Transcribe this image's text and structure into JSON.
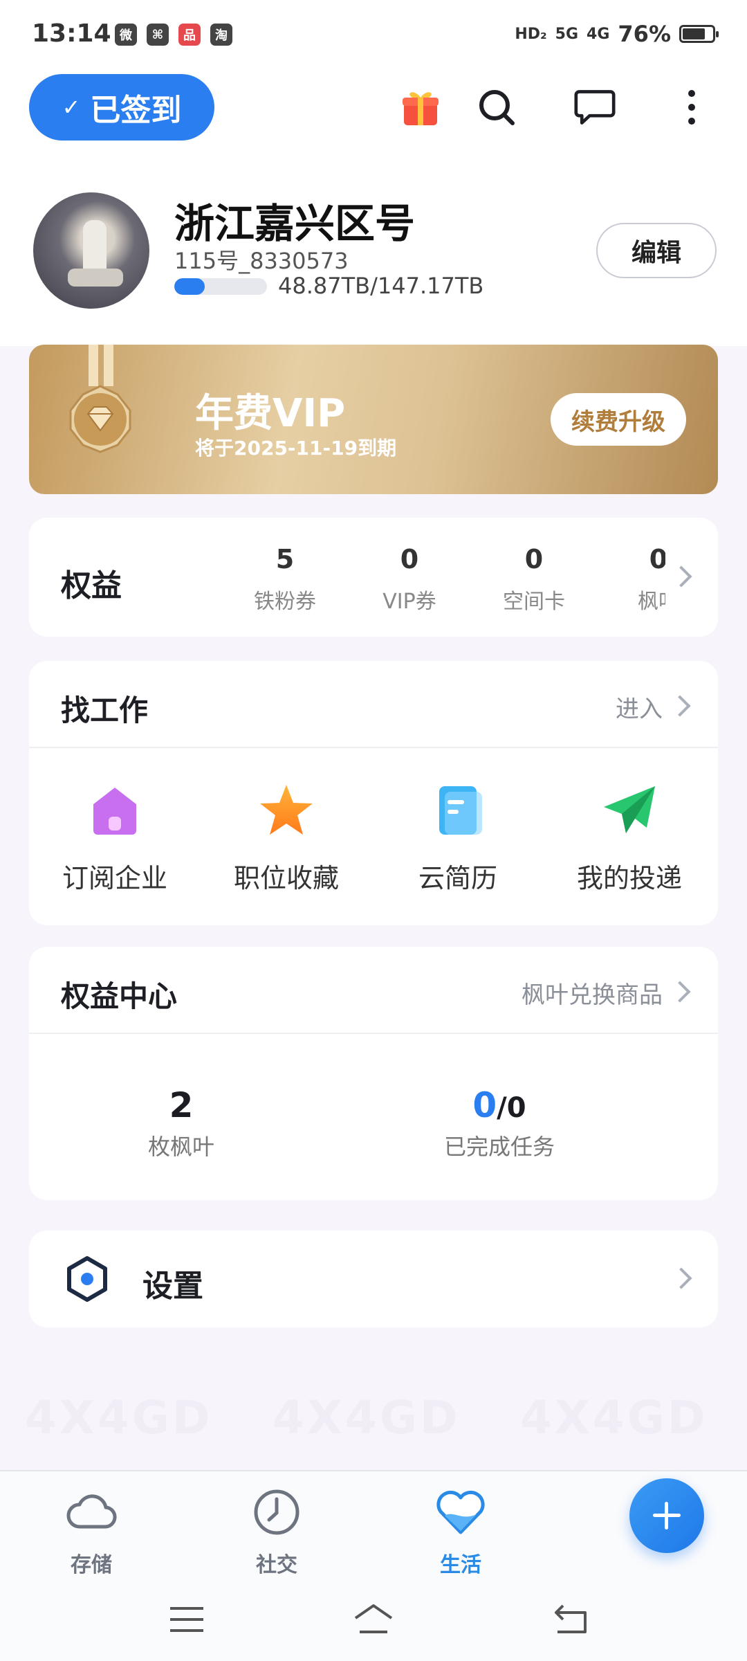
{
  "status_bar": {
    "time": "13:14",
    "app_icons": [
      "微",
      "⌘",
      "品",
      "淘"
    ],
    "hd": "HD₂",
    "net1": "5G",
    "net2": "4G",
    "battery": "76%",
    "battery_level": 0.76
  },
  "header": {
    "signed_label": "已签到",
    "icons": [
      "gift-icon",
      "search-icon",
      "message-icon",
      "more-icon"
    ]
  },
  "profile": {
    "name": "浙江嘉兴区号",
    "id": "115号_8330573",
    "storage_text": "48.87TB/147.17TB",
    "storage_used_fraction": 0.33,
    "edit_label": "编辑"
  },
  "vip": {
    "title": "年费VIP",
    "subtitle": "将于2025-11-19到期",
    "renew_label": "续费升级"
  },
  "rights": {
    "label": "权益",
    "items": [
      {
        "value": "5",
        "label": "铁粉券"
      },
      {
        "value": "0",
        "label": "VIP券"
      },
      {
        "value": "0",
        "label": "空间卡"
      },
      {
        "value": "0",
        "label": "枫叶"
      }
    ]
  },
  "jobs": {
    "title": "找工作",
    "link": "进入",
    "items": [
      {
        "label": "订阅企业",
        "icon": "house-icon"
      },
      {
        "label": "职位收藏",
        "icon": "star-icon"
      },
      {
        "label": "云简历",
        "icon": "resume-icon"
      },
      {
        "label": "我的投递",
        "icon": "paper-plane-icon"
      }
    ]
  },
  "rights_center": {
    "title": "权益中心",
    "link": "枫叶兑换商品",
    "leaves_value": "2",
    "leaves_label": "枚枫叶",
    "tasks_done": "0",
    "tasks_total": "/0",
    "tasks_label": "已完成任务"
  },
  "settings": {
    "label": "设置"
  },
  "watermark": "4X4GD",
  "tabbar": {
    "tabs": [
      {
        "label": "存储",
        "icon": "cloud-icon"
      },
      {
        "label": "社交",
        "icon": "clock-icon"
      },
      {
        "label": "生活",
        "icon": "heart-icon"
      }
    ],
    "active": "生活",
    "accent": "#2A7EF0"
  }
}
